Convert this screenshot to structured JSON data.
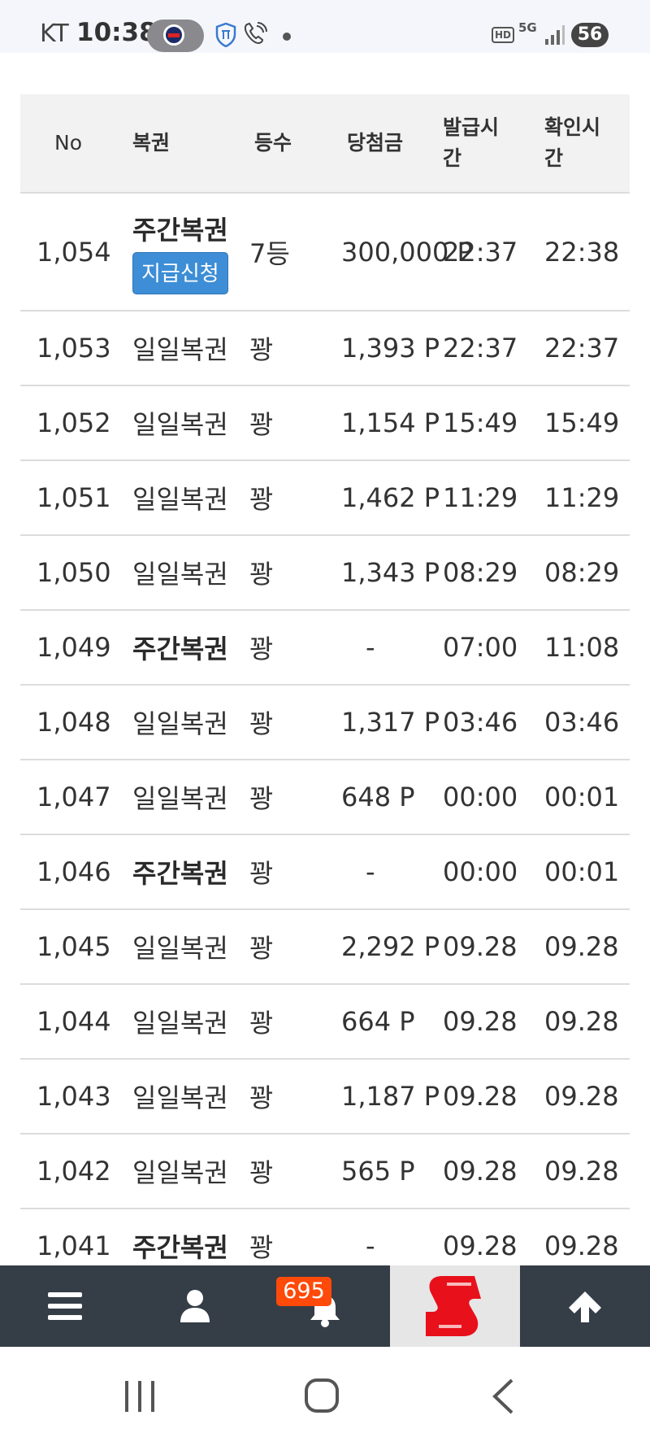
{
  "status_bar": {
    "carrier": "KT",
    "time": "10:38",
    "network": "5G",
    "battery": "56"
  },
  "table": {
    "headers": {
      "no": "No",
      "ticket": "복권",
      "rank": "등수",
      "prize": "당첨금",
      "issued": "발급시간",
      "checked": "확인시간"
    },
    "claim_button": "지급신청",
    "rows": [
      {
        "no": "1,054",
        "ticket": "주간복권",
        "rank": "7등",
        "prize": "300,000 P",
        "issued": "22:37",
        "checked": "22:38"
      },
      {
        "no": "1,053",
        "ticket": "일일복권",
        "rank": "꽝",
        "prize": "1,393 P",
        "issued": "22:37",
        "checked": "22:37"
      },
      {
        "no": "1,052",
        "ticket": "일일복권",
        "rank": "꽝",
        "prize": "1,154 P",
        "issued": "15:49",
        "checked": "15:49"
      },
      {
        "no": "1,051",
        "ticket": "일일복권",
        "rank": "꽝",
        "prize": "1,462 P",
        "issued": "11:29",
        "checked": "11:29"
      },
      {
        "no": "1,050",
        "ticket": "일일복권",
        "rank": "꽝",
        "prize": "1,343 P",
        "issued": "08:29",
        "checked": "08:29"
      },
      {
        "no": "1,049",
        "ticket": "주간복권",
        "rank": "꽝",
        "prize": "-",
        "issued": "07:00",
        "checked": "11:08"
      },
      {
        "no": "1,048",
        "ticket": "일일복권",
        "rank": "꽝",
        "prize": "1,317 P",
        "issued": "03:46",
        "checked": "03:46"
      },
      {
        "no": "1,047",
        "ticket": "일일복권",
        "rank": "꽝",
        "prize": "648 P",
        "issued": "00:00",
        "checked": "00:01"
      },
      {
        "no": "1,046",
        "ticket": "주간복권",
        "rank": "꽝",
        "prize": "-",
        "issued": "00:00",
        "checked": "00:01"
      },
      {
        "no": "1,045",
        "ticket": "일일복권",
        "rank": "꽝",
        "prize": "2,292 P",
        "issued": "09.28",
        "checked": "09.28"
      },
      {
        "no": "1,044",
        "ticket": "일일복권",
        "rank": "꽝",
        "prize": "664 P",
        "issued": "09.28",
        "checked": "09.28"
      },
      {
        "no": "1,043",
        "ticket": "일일복권",
        "rank": "꽝",
        "prize": "1,187 P",
        "issued": "09.28",
        "checked": "09.28"
      },
      {
        "no": "1,042",
        "ticket": "일일복권",
        "rank": "꽝",
        "prize": "565 P",
        "issued": "09.28",
        "checked": "09.28"
      },
      {
        "no": "1,041",
        "ticket": "주간복권",
        "rank": "꽝",
        "prize": "-",
        "issued": "09.28",
        "checked": "09.28"
      }
    ]
  },
  "bottom_nav": {
    "notification_count": "695",
    "items": [
      "menu-icon",
      "user-icon",
      "bell-icon",
      "site-logo",
      "arrow-up-icon"
    ]
  },
  "colors": {
    "nav_background": "#353d47",
    "badge": "#ff4a0a",
    "claim_button": "#3d8ed6",
    "logo_red": "#e8101a"
  }
}
